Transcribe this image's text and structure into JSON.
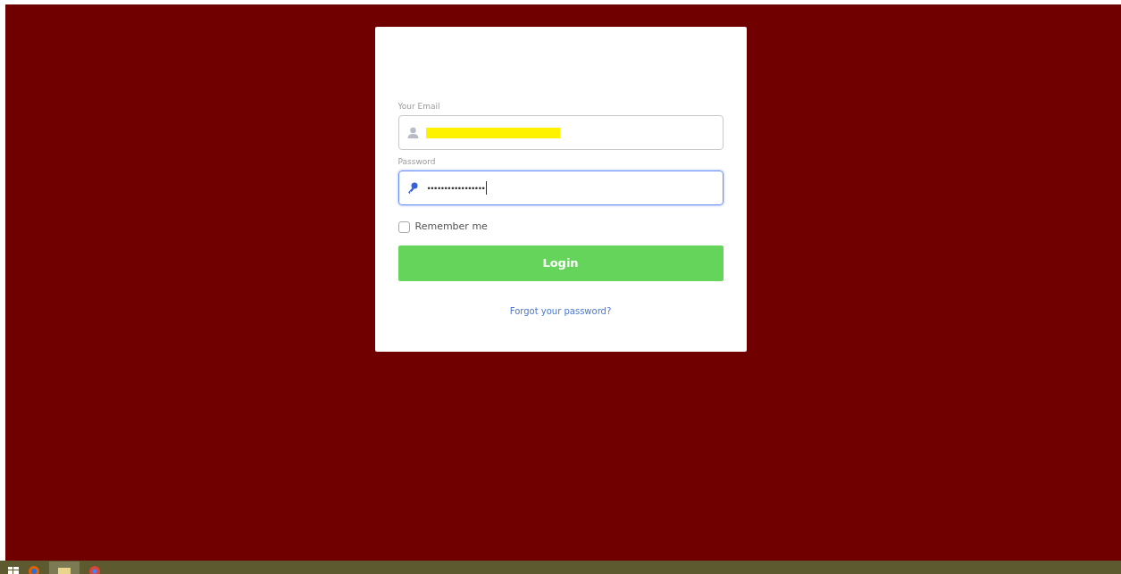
{
  "login_form": {
    "email": {
      "label": "Your Email",
      "redacted": true
    },
    "password": {
      "label": "Password",
      "value": "•••••••••••••••••",
      "focused": true
    },
    "remember_me": {
      "label": "Remember me",
      "checked": false
    },
    "login_button": "Login",
    "forgot_link": "Forgot your password?"
  }
}
